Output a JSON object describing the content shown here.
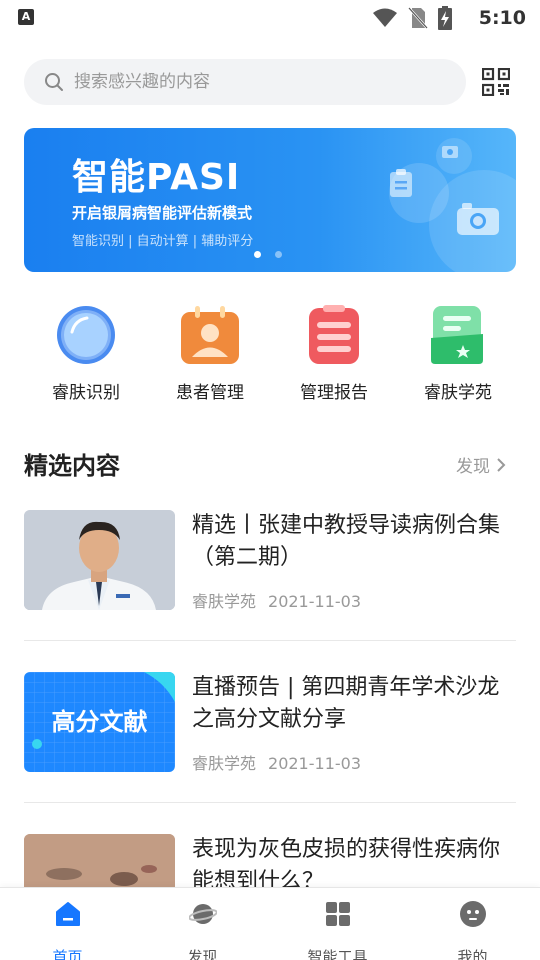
{
  "status_bar": {
    "left_icon_letter": "A",
    "time": "5:10",
    "icons": [
      "wifi-icon",
      "no-sim-icon",
      "battery-charging-icon"
    ]
  },
  "search": {
    "placeholder": "搜索感兴趣的内容"
  },
  "banner": {
    "title": "智能PASI",
    "subtitle": "开启银屑病智能评估新模式",
    "tags": "智能识别 | 自动计算 | 辅助评分",
    "active_slide": 1,
    "slide_count": 2
  },
  "quick_nav": [
    {
      "label": "睿肤识别",
      "icon": "lens-icon"
    },
    {
      "label": "患者管理",
      "icon": "patient-icon"
    },
    {
      "label": "管理报告",
      "icon": "report-icon"
    },
    {
      "label": "睿肤学苑",
      "icon": "academy-icon"
    }
  ],
  "section": {
    "title": "精选内容",
    "more_label": "发现"
  },
  "articles": [
    {
      "title": "精选丨张建中教授导读病例合集（第二期）",
      "source": "睿肤学苑",
      "date": "2021-11-03",
      "thumb": "doctor-portrait"
    },
    {
      "title": "直播预告 | 第四期青年学术沙龙之高分文献分享",
      "source": "睿肤学苑",
      "date": "2021-11-03",
      "thumb": "高分文献"
    },
    {
      "title": "表现为灰色皮损的获得性疾病你能想到什么？",
      "source": "",
      "date": "",
      "thumb": "skin-photo"
    }
  ],
  "tabs": [
    {
      "label": "首页",
      "icon": "home-icon",
      "active": true
    },
    {
      "label": "发现",
      "icon": "planet-icon",
      "active": false
    },
    {
      "label": "智能工具",
      "icon": "grid-icon",
      "active": false
    },
    {
      "label": "我的",
      "icon": "profile-icon",
      "active": false
    }
  ],
  "colors": {
    "accent": "#1677ff",
    "banner_start": "#1a7ff0",
    "banner_end": "#56b6fa"
  }
}
